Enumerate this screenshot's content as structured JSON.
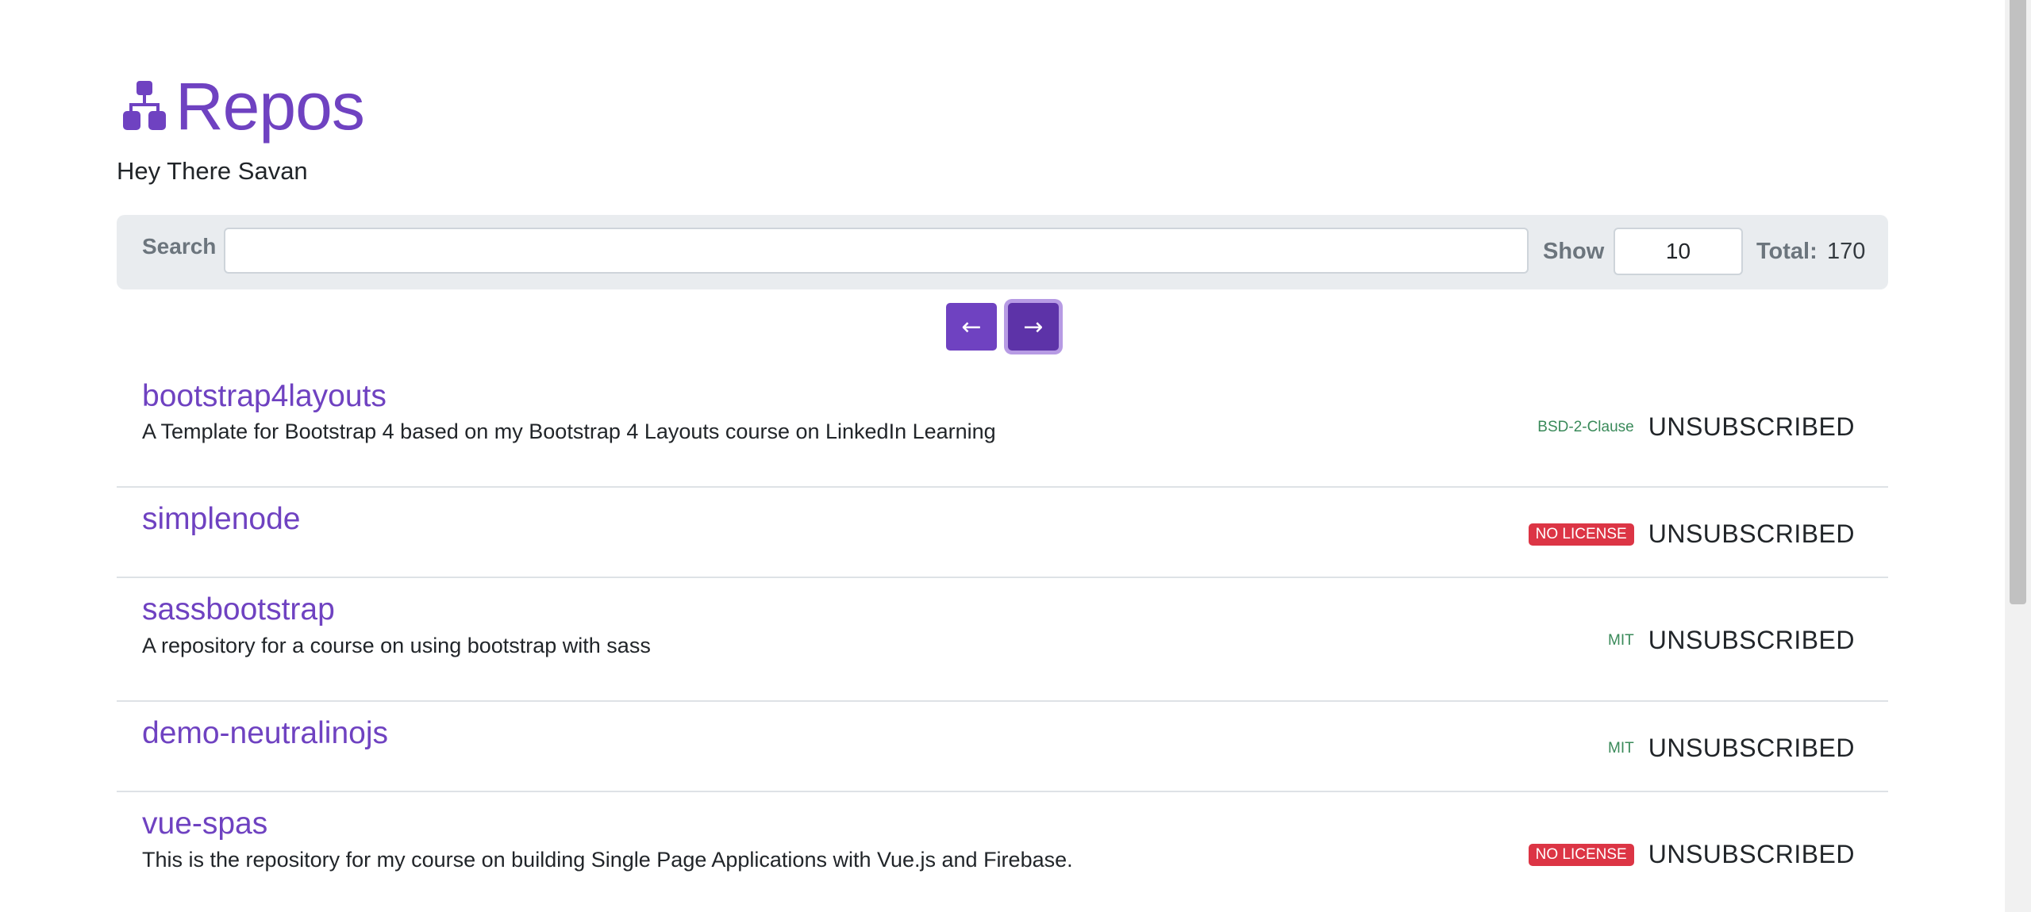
{
  "header": {
    "title": "Repos",
    "title_icon": "sitemap-icon",
    "greeting": "Hey There Savan"
  },
  "toolbar": {
    "search_label": "Search",
    "search_value": "",
    "show_label": "Show",
    "show_value": "10",
    "total_label": "Total:",
    "total_value": "170"
  },
  "pager": {
    "prev_icon": "arrow-left-icon",
    "prev_glyph": "←",
    "next_icon": "arrow-right-icon",
    "next_glyph": "→"
  },
  "repos": [
    {
      "name": "bootstrap4layouts",
      "description": "A Template for Bootstrap 4 based on my Bootstrap 4 Layouts course on LinkedIn Learning",
      "license": "BSD-2-Clause",
      "no_license": false,
      "status": "UNSUBSCRIBED"
    },
    {
      "name": "simplenode",
      "description": "",
      "license": "NO LICENSE",
      "no_license": true,
      "status": "UNSUBSCRIBED"
    },
    {
      "name": "sassbootstrap",
      "description": "A repository for a course on using bootstrap with sass",
      "license": "MIT",
      "no_license": false,
      "status": "UNSUBSCRIBED"
    },
    {
      "name": "demo-neutralinojs",
      "description": "",
      "license": "MIT",
      "no_license": false,
      "status": "UNSUBSCRIBED"
    },
    {
      "name": "vue-spas",
      "description": "This is the repository for my course on building Single Page Applications with Vue.js and Firebase.",
      "license": "NO LICENSE",
      "no_license": true,
      "status": "UNSUBSCRIBED"
    }
  ],
  "colors": {
    "accent": "#6f42c1",
    "no_license_badge": "#dc3545",
    "license_text": "#3a8a5a"
  }
}
